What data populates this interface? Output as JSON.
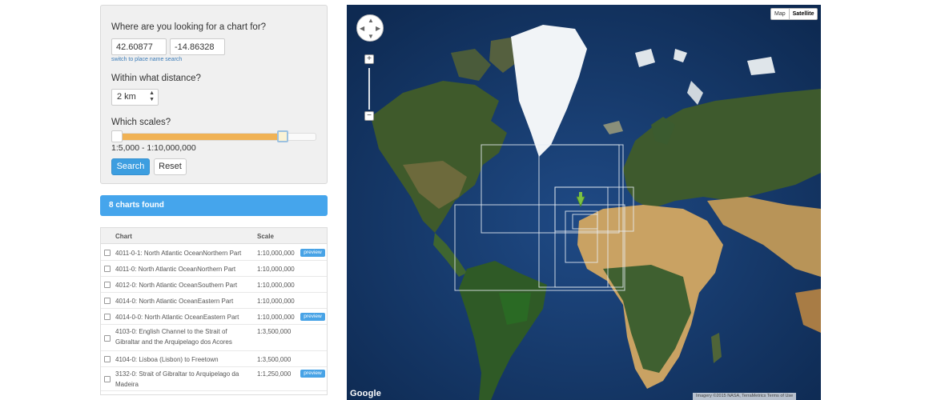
{
  "search": {
    "question": "Where are you looking for a chart for?",
    "lat_value": "42.60877",
    "lon_value": "-14.86328",
    "switch_link": "switch to place name search",
    "distance_label": "Within what distance?",
    "distance_value": "2 km",
    "scales_label": "Which scales?",
    "scale_range": "1:5,000 - 1:10,000,000",
    "scale_slider_fraction": 0.85,
    "search_button": "Search",
    "reset_button": "Reset"
  },
  "results": {
    "found_text": "8 charts found",
    "col_chart": "Chart",
    "col_scale": "Scale",
    "rows": [
      {
        "name": "4011-0-1: North Atlantic OceanNorthern Part",
        "scale": "1:10,000,000",
        "preview": "preview"
      },
      {
        "name": "4011-0: North Atlantic OceanNorthern Part",
        "scale": "1:10,000,000",
        "preview": ""
      },
      {
        "name": "4012-0: North Atlantic OceanSouthern Part",
        "scale": "1:10,000,000",
        "preview": ""
      },
      {
        "name": "4014-0: North Atlantic OceanEastern Part",
        "scale": "1:10,000,000",
        "preview": ""
      },
      {
        "name": "4014-0-0: North Atlantic OceanEastern Part",
        "scale": "1:10,000,000",
        "preview": "preview"
      },
      {
        "name": "4103-0: English Channel to the Strait of Gibraltar and the Arquipelago dos Acores",
        "scale": "1:3,500,000",
        "preview": ""
      },
      {
        "name": "4104-0: Lisboa (Lisbon) to Freetown",
        "scale": "1:3,500,000",
        "preview": ""
      },
      {
        "name": "3132-0: Strait of Gibraltar to Arquipelago da Madeira",
        "scale": "1:1,250,000",
        "preview": "preview"
      }
    ]
  },
  "map": {
    "type_map": "Map",
    "type_satellite": "Satellite",
    "zoom_in": "+",
    "zoom_out": "−",
    "google_logo": "Google",
    "attribution": "Imagery ©2015 NASA, TerraMetrics   Terms of Use",
    "pan_arrows": [
      "▲",
      "▼",
      "◀",
      "▶"
    ]
  },
  "colors": {
    "accent": "#3d9ee0",
    "found_bar": "#45a5ec",
    "slider_fill": "#f0b255",
    "preview_badge": "#48a3e6",
    "ocean": "#1b3f74",
    "land": "#3d5a2a",
    "desert": "#c9a263",
    "ice": "#f4f6f8",
    "marker": "#7bc043"
  },
  "icons": {
    "pan": "pan-control-icon",
    "marker": "location-marker-icon",
    "select_arrows": "select-arrows-icon"
  }
}
